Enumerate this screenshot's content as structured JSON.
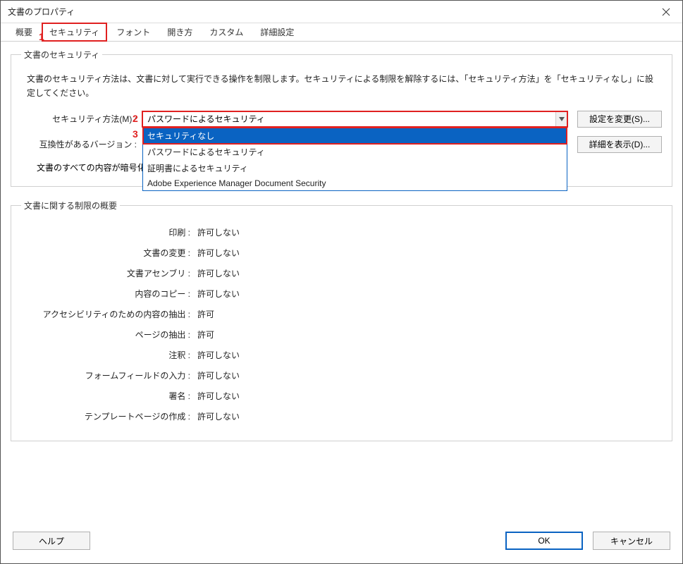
{
  "window": {
    "title": "文書のプロパティ"
  },
  "tabs": {
    "items": [
      {
        "label": "概要"
      },
      {
        "label": "セキュリティ"
      },
      {
        "label": "フォント"
      },
      {
        "label": "開き方"
      },
      {
        "label": "カスタム"
      },
      {
        "label": "詳細設定"
      }
    ]
  },
  "annotations": {
    "n1": "1",
    "n2": "2",
    "n3": "3"
  },
  "security_group": {
    "legend": "文書のセキュリティ",
    "description": "文書のセキュリティ方法は、文書に対して実行できる操作を制限します。セキュリティによる制限を解除するには、「セキュリティ方法」を「セキュリティなし」に設定してください。",
    "method_label": "セキュリティ方法(M) :",
    "method_value": "パスワードによるセキュリティ",
    "options": [
      "セキュリティなし",
      "パスワードによるセキュリティ",
      "証明書によるセキュリティ",
      "Adobe Experience Manager Document Security"
    ],
    "compat_label": "互換性があるバージョン :",
    "encrypt_label": "文書のすべての内容が暗号化",
    "change_btn": "設定を変更(S)...",
    "detail_btn": "詳細を表示(D)..."
  },
  "restrictions": {
    "legend": "文書に関する制限の概要",
    "items": [
      {
        "label": "印刷 :",
        "value": "許可しない"
      },
      {
        "label": "文書の変更 :",
        "value": "許可しない"
      },
      {
        "label": "文書アセンブリ :",
        "value": "許可しない"
      },
      {
        "label": "内容のコピー :",
        "value": "許可しない"
      },
      {
        "label": "アクセシビリティのための内容の抽出 :",
        "value": "許可"
      },
      {
        "label": "ページの抽出 :",
        "value": "許可"
      },
      {
        "label": "注釈 :",
        "value": "許可しない"
      },
      {
        "label": "フォームフィールドの入力 :",
        "value": "許可しない"
      },
      {
        "label": "署名 :",
        "value": "許可しない"
      },
      {
        "label": "テンプレートページの作成 :",
        "value": "許可しない"
      }
    ]
  },
  "footer": {
    "help": "ヘルプ",
    "ok": "OK",
    "cancel": "キャンセル"
  }
}
